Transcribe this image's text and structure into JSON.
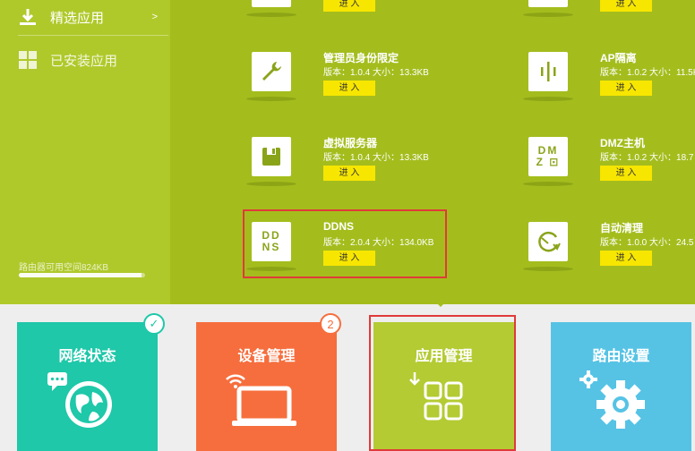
{
  "sidebar": {
    "featured_label": "精选应用",
    "featured_arrow": ">",
    "installed_label": "已安装应用",
    "storage_text": "路由器可用空间824KB",
    "storage_fraction": 0.97
  },
  "apps": {
    "enter_label": "进 入",
    "row0": [
      {
        "name": ""
      },
      {
        "name": ""
      }
    ],
    "admin_limit": {
      "name": "管理员身份限定",
      "meta": "版本：1.0.4  大小：13.3KB",
      "icon": "wrench-icon"
    },
    "ap_isolation": {
      "name": "AP隔离",
      "meta": "版本：1.0.2  大小：11.5KB",
      "icon": "isolation-icon"
    },
    "virtual_server": {
      "name": "虚拟服务器",
      "meta": "版本：1.0.4  大小：13.3KB",
      "icon": "floppy-icon"
    },
    "dmz": {
      "name": "DMZ主机",
      "meta": "版本：1.0.2  大小：18.7",
      "icon": "dmz-icon",
      "tile_line1": "DM",
      "tile_line2": "Z ⊡"
    },
    "ddns": {
      "name": "DDNS",
      "meta": "版本：2.0.4  大小：134.0KB",
      "icon": "ddns-icon",
      "tile_line1": "DD",
      "tile_line2": "NS"
    },
    "auto_clean": {
      "name": "自动清理",
      "meta": "版本：1.0.0  大小：24.5",
      "icon": "clean-icon"
    }
  },
  "nav": {
    "network": {
      "label": "网络状态",
      "color": "#1ec8a9",
      "icon": "globe-chat-icon"
    },
    "devices": {
      "label": "设备管理",
      "color": "#f66e3d",
      "icon": "laptop-wifi-icon",
      "badge": "2"
    },
    "apps": {
      "label": "应用管理",
      "color": "#b4cb33",
      "icon": "apps-grid-icon"
    },
    "router": {
      "label": "路由设置",
      "color": "#56c3e5",
      "icon": "gear-icon"
    }
  },
  "accent": {
    "top_bg": "#a4bd1d",
    "button_yellow": "#f7e600",
    "highlight_red": "#e03a3a"
  }
}
